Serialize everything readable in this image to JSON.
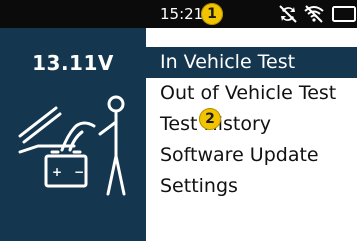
{
  "status_bar": {
    "time": "15:21",
    "icons": [
      "sync-off-icon",
      "wifi-off-icon",
      "battery-icon"
    ]
  },
  "left_panel": {
    "voltage": "13.11V",
    "illustration": "car-battery-jump-icon"
  },
  "menu": {
    "items": [
      {
        "label": "In Vehicle Test",
        "selected": true
      },
      {
        "label": "Out of Vehicle Test",
        "selected": false
      },
      {
        "label": "Test History",
        "selected": false
      },
      {
        "label": "Software Update",
        "selected": false
      },
      {
        "label": "Settings",
        "selected": false
      }
    ]
  },
  "markers": [
    "1",
    "2"
  ],
  "colors": {
    "accent": "#14364f",
    "status_bar": "#0b0b0b",
    "marker": "#f2c400"
  }
}
